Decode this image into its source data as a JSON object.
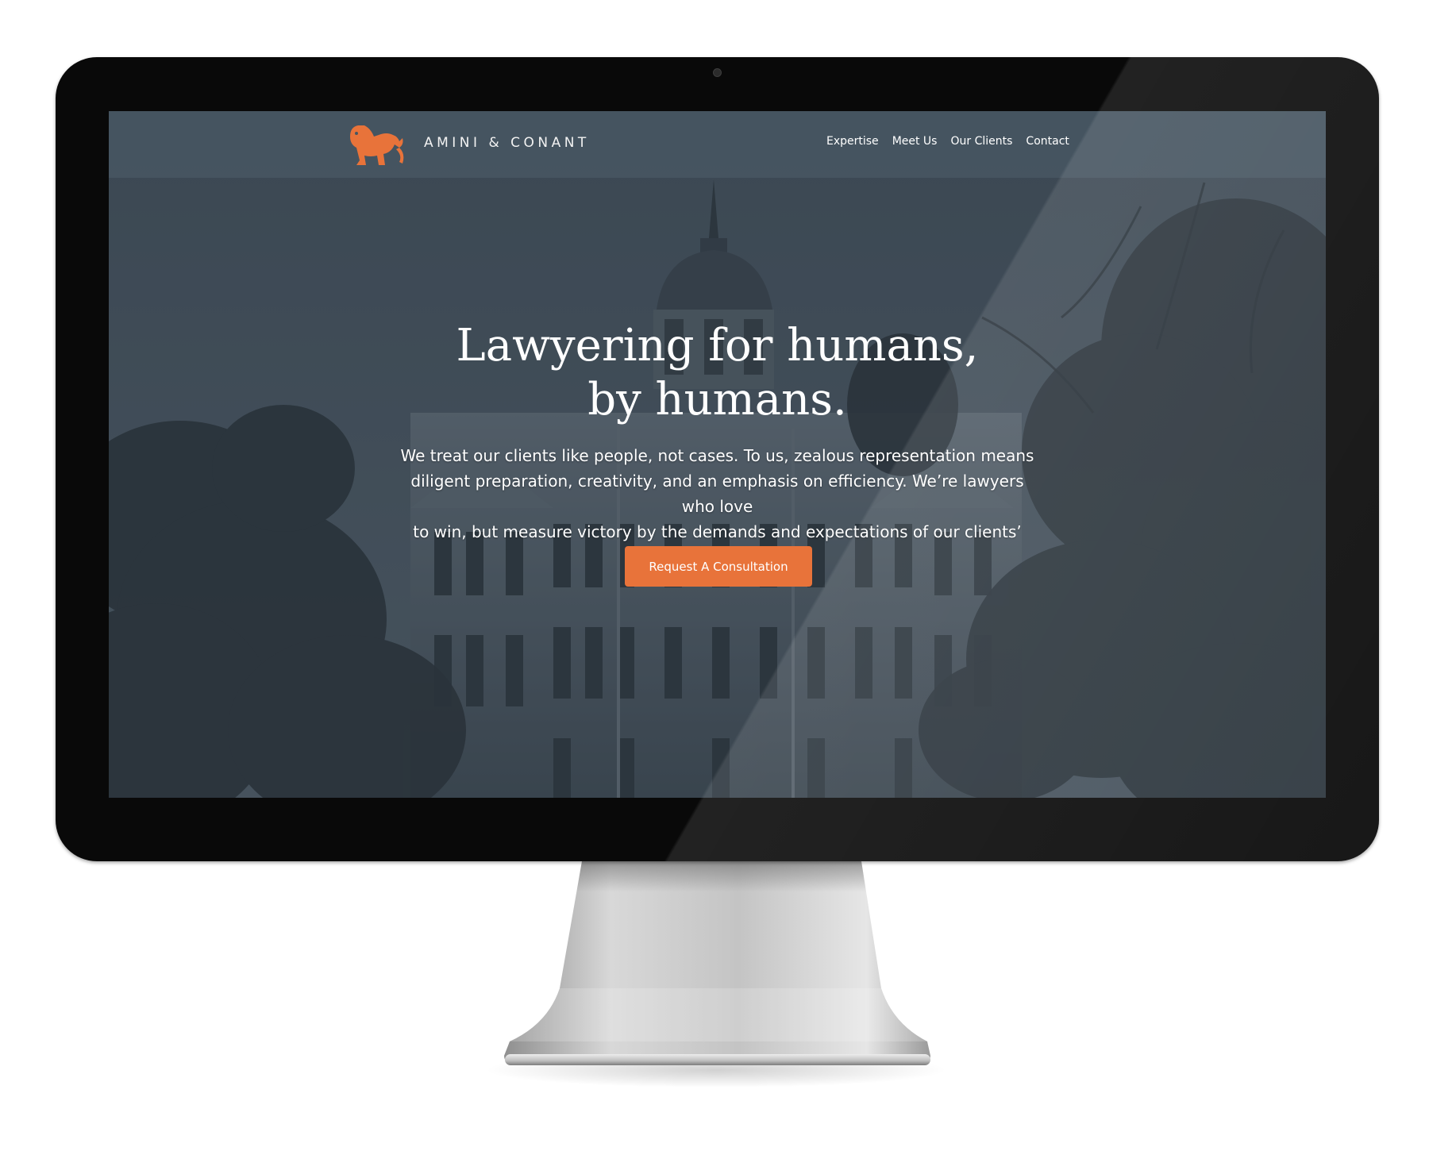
{
  "brand": {
    "name": "AMINI & CONANT",
    "logo_icon": "lion-icon",
    "logo_color": "#e8733a"
  },
  "nav": {
    "items": [
      {
        "label": "Expertise"
      },
      {
        "label": "Meet Us"
      },
      {
        "label": "Our Clients"
      },
      {
        "label": "Contact"
      }
    ]
  },
  "hero": {
    "headline_line1": "Lawyering for humans,",
    "headline_line2": "by humans.",
    "body_line1": "We treat our clients like people, not cases. To us, zealous representation means",
    "body_line2": "diligent preparation, creativity, and an emphasis on efficiency. We’re lawyers who love",
    "body_line3": "to win, but measure victory by the demands and expectations of our clients’ lives.",
    "cta_label": "Request A Consultation",
    "background_image": "courthouse-photo"
  },
  "colors": {
    "accent": "#e8733a",
    "nav_bg": "#465662",
    "overlay": "#3f4b55",
    "text": "#ffffff"
  }
}
